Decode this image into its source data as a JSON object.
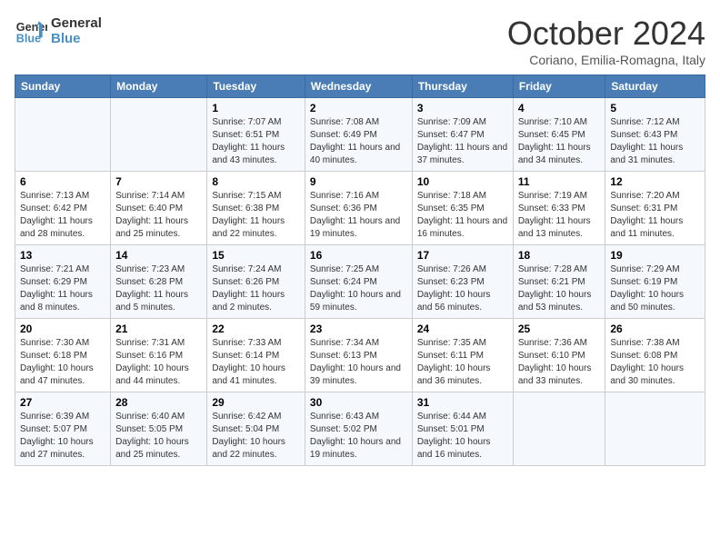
{
  "logo": {
    "line1": "General",
    "line2": "Blue"
  },
  "title": "October 2024",
  "location": "Coriano, Emilia-Romagna, Italy",
  "weekdays": [
    "Sunday",
    "Monday",
    "Tuesday",
    "Wednesday",
    "Thursday",
    "Friday",
    "Saturday"
  ],
  "weeks": [
    [
      {
        "day": null
      },
      {
        "day": null
      },
      {
        "day": "1",
        "sunrise": "Sunrise: 7:07 AM",
        "sunset": "Sunset: 6:51 PM",
        "daylight": "Daylight: 11 hours and 43 minutes."
      },
      {
        "day": "2",
        "sunrise": "Sunrise: 7:08 AM",
        "sunset": "Sunset: 6:49 PM",
        "daylight": "Daylight: 11 hours and 40 minutes."
      },
      {
        "day": "3",
        "sunrise": "Sunrise: 7:09 AM",
        "sunset": "Sunset: 6:47 PM",
        "daylight": "Daylight: 11 hours and 37 minutes."
      },
      {
        "day": "4",
        "sunrise": "Sunrise: 7:10 AM",
        "sunset": "Sunset: 6:45 PM",
        "daylight": "Daylight: 11 hours and 34 minutes."
      },
      {
        "day": "5",
        "sunrise": "Sunrise: 7:12 AM",
        "sunset": "Sunset: 6:43 PM",
        "daylight": "Daylight: 11 hours and 31 minutes."
      }
    ],
    [
      {
        "day": "6",
        "sunrise": "Sunrise: 7:13 AM",
        "sunset": "Sunset: 6:42 PM",
        "daylight": "Daylight: 11 hours and 28 minutes."
      },
      {
        "day": "7",
        "sunrise": "Sunrise: 7:14 AM",
        "sunset": "Sunset: 6:40 PM",
        "daylight": "Daylight: 11 hours and 25 minutes."
      },
      {
        "day": "8",
        "sunrise": "Sunrise: 7:15 AM",
        "sunset": "Sunset: 6:38 PM",
        "daylight": "Daylight: 11 hours and 22 minutes."
      },
      {
        "day": "9",
        "sunrise": "Sunrise: 7:16 AM",
        "sunset": "Sunset: 6:36 PM",
        "daylight": "Daylight: 11 hours and 19 minutes."
      },
      {
        "day": "10",
        "sunrise": "Sunrise: 7:18 AM",
        "sunset": "Sunset: 6:35 PM",
        "daylight": "Daylight: 11 hours and 16 minutes."
      },
      {
        "day": "11",
        "sunrise": "Sunrise: 7:19 AM",
        "sunset": "Sunset: 6:33 PM",
        "daylight": "Daylight: 11 hours and 13 minutes."
      },
      {
        "day": "12",
        "sunrise": "Sunrise: 7:20 AM",
        "sunset": "Sunset: 6:31 PM",
        "daylight": "Daylight: 11 hours and 11 minutes."
      }
    ],
    [
      {
        "day": "13",
        "sunrise": "Sunrise: 7:21 AM",
        "sunset": "Sunset: 6:29 PM",
        "daylight": "Daylight: 11 hours and 8 minutes."
      },
      {
        "day": "14",
        "sunrise": "Sunrise: 7:23 AM",
        "sunset": "Sunset: 6:28 PM",
        "daylight": "Daylight: 11 hours and 5 minutes."
      },
      {
        "day": "15",
        "sunrise": "Sunrise: 7:24 AM",
        "sunset": "Sunset: 6:26 PM",
        "daylight": "Daylight: 11 hours and 2 minutes."
      },
      {
        "day": "16",
        "sunrise": "Sunrise: 7:25 AM",
        "sunset": "Sunset: 6:24 PM",
        "daylight": "Daylight: 10 hours and 59 minutes."
      },
      {
        "day": "17",
        "sunrise": "Sunrise: 7:26 AM",
        "sunset": "Sunset: 6:23 PM",
        "daylight": "Daylight: 10 hours and 56 minutes."
      },
      {
        "day": "18",
        "sunrise": "Sunrise: 7:28 AM",
        "sunset": "Sunset: 6:21 PM",
        "daylight": "Daylight: 10 hours and 53 minutes."
      },
      {
        "day": "19",
        "sunrise": "Sunrise: 7:29 AM",
        "sunset": "Sunset: 6:19 PM",
        "daylight": "Daylight: 10 hours and 50 minutes."
      }
    ],
    [
      {
        "day": "20",
        "sunrise": "Sunrise: 7:30 AM",
        "sunset": "Sunset: 6:18 PM",
        "daylight": "Daylight: 10 hours and 47 minutes."
      },
      {
        "day": "21",
        "sunrise": "Sunrise: 7:31 AM",
        "sunset": "Sunset: 6:16 PM",
        "daylight": "Daylight: 10 hours and 44 minutes."
      },
      {
        "day": "22",
        "sunrise": "Sunrise: 7:33 AM",
        "sunset": "Sunset: 6:14 PM",
        "daylight": "Daylight: 10 hours and 41 minutes."
      },
      {
        "day": "23",
        "sunrise": "Sunrise: 7:34 AM",
        "sunset": "Sunset: 6:13 PM",
        "daylight": "Daylight: 10 hours and 39 minutes."
      },
      {
        "day": "24",
        "sunrise": "Sunrise: 7:35 AM",
        "sunset": "Sunset: 6:11 PM",
        "daylight": "Daylight: 10 hours and 36 minutes."
      },
      {
        "day": "25",
        "sunrise": "Sunrise: 7:36 AM",
        "sunset": "Sunset: 6:10 PM",
        "daylight": "Daylight: 10 hours and 33 minutes."
      },
      {
        "day": "26",
        "sunrise": "Sunrise: 7:38 AM",
        "sunset": "Sunset: 6:08 PM",
        "daylight": "Daylight: 10 hours and 30 minutes."
      }
    ],
    [
      {
        "day": "27",
        "sunrise": "Sunrise: 6:39 AM",
        "sunset": "Sunset: 5:07 PM",
        "daylight": "Daylight: 10 hours and 27 minutes."
      },
      {
        "day": "28",
        "sunrise": "Sunrise: 6:40 AM",
        "sunset": "Sunset: 5:05 PM",
        "daylight": "Daylight: 10 hours and 25 minutes."
      },
      {
        "day": "29",
        "sunrise": "Sunrise: 6:42 AM",
        "sunset": "Sunset: 5:04 PM",
        "daylight": "Daylight: 10 hours and 22 minutes."
      },
      {
        "day": "30",
        "sunrise": "Sunrise: 6:43 AM",
        "sunset": "Sunset: 5:02 PM",
        "daylight": "Daylight: 10 hours and 19 minutes."
      },
      {
        "day": "31",
        "sunrise": "Sunrise: 6:44 AM",
        "sunset": "Sunset: 5:01 PM",
        "daylight": "Daylight: 10 hours and 16 minutes."
      },
      {
        "day": null
      },
      {
        "day": null
      }
    ]
  ]
}
